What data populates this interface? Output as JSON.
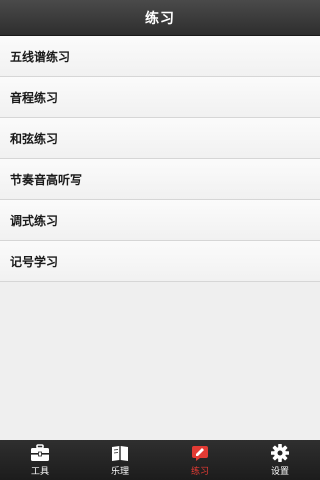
{
  "header": {
    "title": "练习"
  },
  "menu": {
    "items": [
      {
        "label": "五线谱练习"
      },
      {
        "label": "音程练习"
      },
      {
        "label": "和弦练习"
      },
      {
        "label": "节奏音高听写"
      },
      {
        "label": "调式练习"
      },
      {
        "label": "记号学习"
      }
    ]
  },
  "tabs": [
    {
      "label": "工具",
      "icon": "toolbox-icon",
      "active": false
    },
    {
      "label": "乐理",
      "icon": "book-icon",
      "active": false
    },
    {
      "label": "练习",
      "icon": "pencil-note-icon",
      "active": true
    },
    {
      "label": "设置",
      "icon": "gear-icon",
      "active": false
    }
  ],
  "colors": {
    "accent": "#e23b34",
    "header_bg": "#3a3a3a",
    "tabbar_bg": "#222222",
    "list_bg": "#f4f4f4"
  }
}
